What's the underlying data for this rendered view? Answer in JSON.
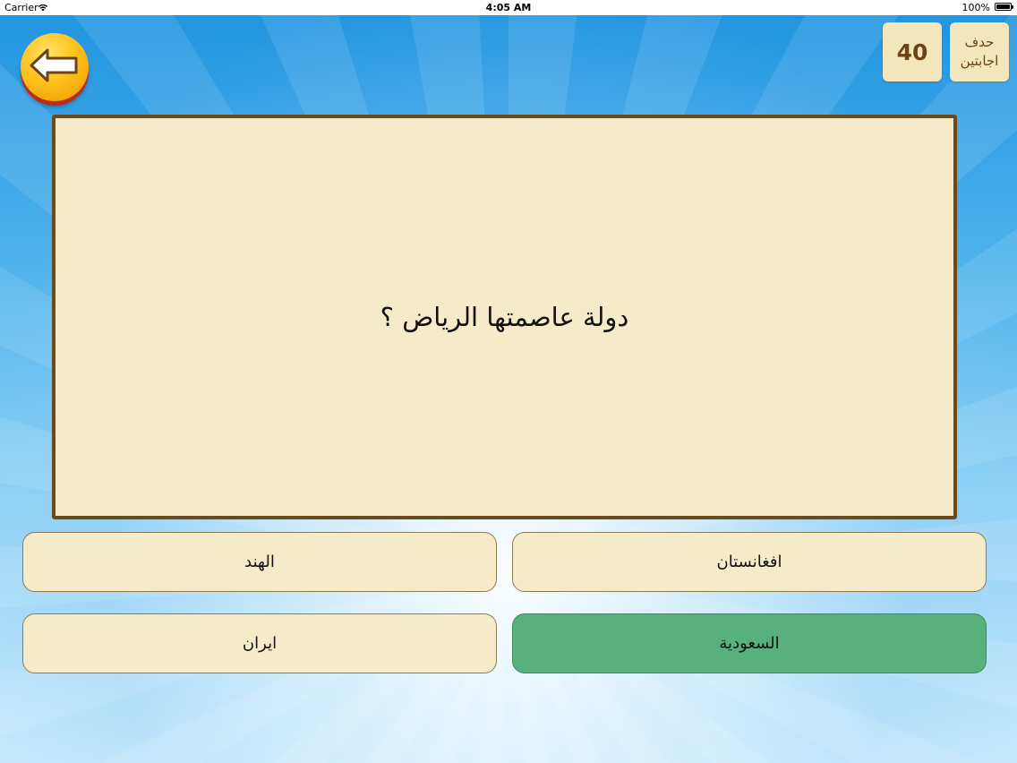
{
  "status_bar": {
    "carrier": "Carrier",
    "time": "4:05 AM",
    "battery": "100%"
  },
  "header": {
    "back_icon": "left-arrow-icon",
    "score": "40",
    "remove_two": {
      "line1": "حدف",
      "line2": "اجابتين"
    }
  },
  "question": {
    "text": "دولة عاصمتها الرياض ؟"
  },
  "answers": [
    {
      "label": "الهند",
      "correct": false
    },
    {
      "label": "افغانستان",
      "correct": false
    },
    {
      "label": "ايران",
      "correct": false
    },
    {
      "label": "السعودية",
      "correct": true
    }
  ],
  "colors": {
    "card": "#f5ebc8",
    "card_border": "#6b4a1c",
    "correct": "#58b07c",
    "back_button": "#ffc21c",
    "back_button_rim": "#c0281b"
  }
}
